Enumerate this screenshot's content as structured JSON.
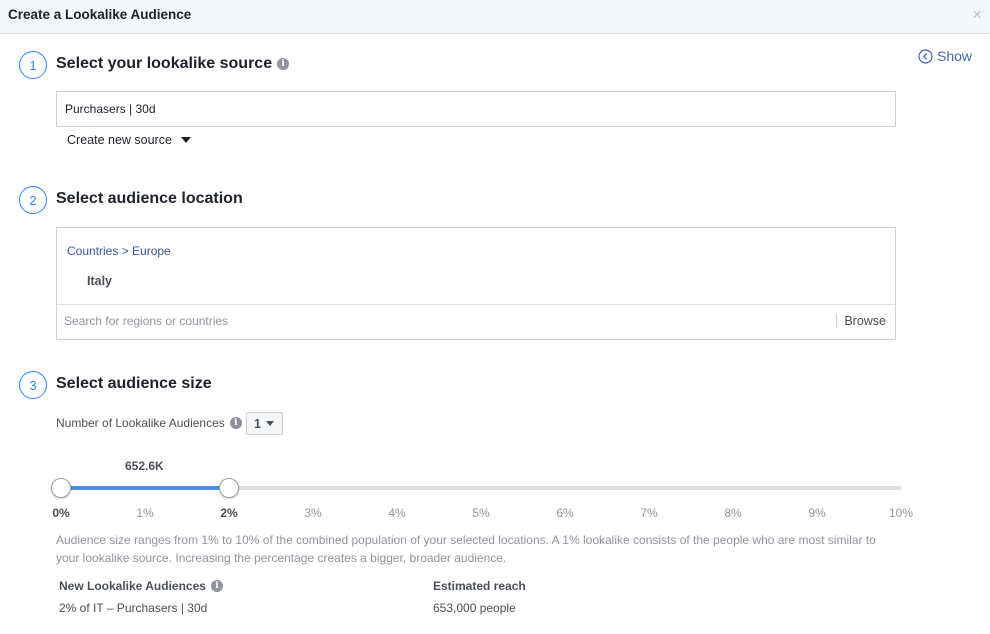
{
  "dialog": {
    "title": "Create a Lookalike Audience",
    "close_glyph": "×",
    "show_label": "Show"
  },
  "step1": {
    "number": "1",
    "title": "Select your lookalike source",
    "source_value": "Purchasers | 30d",
    "create_source_label": "Create new source"
  },
  "step2": {
    "number": "2",
    "title": "Select audience location",
    "breadcrumb": "Countries > Europe",
    "selected_country": "Italy",
    "search_placeholder": "Search for regions or countries",
    "browse_label": "Browse"
  },
  "step3": {
    "number": "3",
    "title": "Select audience size",
    "num_audiences_label": "Number of Lookalike Audiences",
    "num_audiences_value": "1",
    "slider": {
      "value_label": "652.6K",
      "range_start_pct": 0,
      "range_end_pct": 2,
      "max_pct": 10,
      "ticks": [
        "0%",
        "1%",
        "2%",
        "3%",
        "4%",
        "5%",
        "6%",
        "7%",
        "8%",
        "9%",
        "10%"
      ]
    },
    "help_text": "Audience size ranges from 1% to 10% of the combined population of your selected locations. A 1% lookalike consists of the people who are most similar to your lookalike source. Increasing the percentage creates a bigger, broader audience.",
    "new_audiences_header": "New Lookalike Audiences",
    "new_audience_value": "2% of IT – Purchasers | 30d",
    "estimated_reach_header": "Estimated reach",
    "estimated_reach_value": "653,000 people"
  },
  "colors": {
    "accent": "#2d88ff",
    "slider_fill": "#4a90e2",
    "link": "#365899"
  },
  "icons": {
    "info": "info-icon",
    "close": "close-icon",
    "show": "chevron-left-circle-icon",
    "dropdown": "caret-down-icon"
  }
}
